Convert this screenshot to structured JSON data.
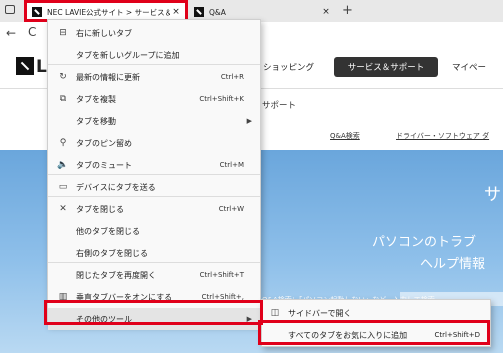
{
  "tabs": [
    {
      "title": "NEC LAVIE公式サイト > サービス＆サ",
      "close": "×"
    },
    {
      "title": "Q&A",
      "close": "×"
    }
  ],
  "new_tab_glyph": "+",
  "toolbar": {
    "back": "←",
    "refresh": "C"
  },
  "page": {
    "logo_text": "LAV",
    "nav": {
      "shopping": "ショッピング",
      "support": "サービス＆サポート",
      "mypage": "マイペー"
    },
    "sub_support": "サポート",
    "qa_link": "Q&A検索",
    "driver_link": "ドライバー・ソフトウェア ダ",
    "hero": {
      "sa": "サ",
      "line1": "パソコンのトラブ",
      "line2": "ヘルプ情報",
      "search_text": "Q&A検索：「パソコン起動しない」など、入力して検索"
    }
  },
  "menu": {
    "items": [
      {
        "icon": "new-tab-right-icon",
        "glyph": "⊟",
        "label": "右に新しいタブ",
        "shortcut": "",
        "submenu": false
      },
      {
        "icon": "",
        "glyph": "",
        "label": "タブを新しいグループに追加",
        "shortcut": "",
        "submenu": false
      },
      {
        "icon": "refresh-icon",
        "glyph": "↻",
        "label": "最新の情報に更新",
        "shortcut": "Ctrl+R",
        "submenu": false
      },
      {
        "icon": "duplicate-icon",
        "glyph": "⧉",
        "label": "タブを複製",
        "shortcut": "Ctrl+Shift+K",
        "submenu": false
      },
      {
        "icon": "",
        "glyph": "",
        "label": "タブを移動",
        "shortcut": "",
        "submenu": true
      },
      {
        "icon": "pin-icon",
        "glyph": "⚲",
        "label": "タブのピン留め",
        "shortcut": "",
        "submenu": false
      },
      {
        "icon": "mute-icon",
        "glyph": "🔈",
        "label": "タブのミュート",
        "shortcut": "Ctrl+M",
        "submenu": false
      },
      {
        "icon": "send-device-icon",
        "glyph": "▭",
        "label": "デバイスにタブを送る",
        "shortcut": "",
        "submenu": false
      },
      {
        "icon": "close-icon",
        "glyph": "✕",
        "label": "タブを閉じる",
        "shortcut": "Ctrl+W",
        "submenu": false
      },
      {
        "icon": "",
        "glyph": "",
        "label": "他のタブを閉じる",
        "shortcut": "",
        "submenu": false
      },
      {
        "icon": "",
        "glyph": "",
        "label": "右側のタブを閉じる",
        "shortcut": "",
        "submenu": false
      },
      {
        "icon": "",
        "glyph": "",
        "label": "閉じたタブを再度開く",
        "shortcut": "Ctrl+Shift+T",
        "submenu": false
      },
      {
        "icon": "vertical-tabs-icon",
        "glyph": "▥",
        "label": "垂直タブバーをオンにする",
        "shortcut": "Ctrl+Shift+,",
        "submenu": false
      },
      {
        "icon": "",
        "glyph": "",
        "label": "その他のツール",
        "shortcut": "",
        "submenu": true
      }
    ],
    "submenu_arrow": "▶"
  },
  "submenu": {
    "items": [
      {
        "icon": "sidebar-icon",
        "glyph": "◫",
        "label": "サイドバーで開く",
        "shortcut": ""
      },
      {
        "icon": "",
        "glyph": "",
        "label": "すべてのタブをお気に入りに追加",
        "shortcut": "Ctrl+Shift+D"
      }
    ]
  },
  "colors": {
    "highlight": "#e0001a",
    "tab_bar": "#e8e8e8",
    "support_button": "#333333"
  }
}
